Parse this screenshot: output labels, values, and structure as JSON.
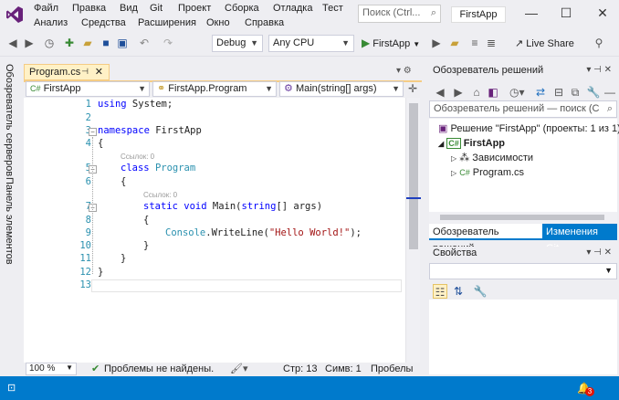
{
  "menu": {
    "row1": [
      "Файл",
      "Правка",
      "Вид",
      "Git",
      "Проект",
      "Сборка",
      "Отладка",
      "Тест"
    ],
    "row2": [
      "Анализ",
      "Средства",
      "Расширения",
      "Окно",
      "Справка"
    ]
  },
  "search": {
    "placeholder": "Поиск (Ctrl..."
  },
  "window": {
    "title": "FirstApp"
  },
  "toolbar": {
    "config": "Debug",
    "platform": "Any CPU",
    "run_label": "FirstApp",
    "liveshare_label": "Live Share"
  },
  "side_rail": {
    "server_explorer": "Обозреватель серверов",
    "toolbox": "Панель элементов"
  },
  "document_tab": {
    "label": "Program.cs"
  },
  "navbar": {
    "project": "FirstApp",
    "type": "FirstApp.Program",
    "member": "Main(string[] args)"
  },
  "code": {
    "line_numbers": [
      "1",
      "2",
      "3",
      "4",
      "5",
      "6",
      "7",
      "8",
      "9",
      "10",
      "11",
      "12",
      "13"
    ],
    "refs_label": "Ссылок: 0",
    "using": "using",
    "system": " System;",
    "namespace": "namespace",
    "ns_name": " FirstApp",
    "open_brace": "{",
    "close_brace": "}",
    "class_kw": "class",
    "class_name": "Program",
    "static_kw": "static",
    "void_kw": "void",
    "main": " Main(",
    "string_kw": "string",
    "args_rest": "[] args)",
    "console": "Console",
    "writeline": ".WriteLine(",
    "hello": "\"Hello World!\"",
    "stmt_end": ");"
  },
  "editor_status": {
    "zoom": "100 %",
    "issues": "Проблемы не найдены.",
    "line": "Стр: 13",
    "col": "Симв: 1",
    "spaces": "Пробелы"
  },
  "solution_explorer": {
    "title": "Обозреватель решений",
    "search_placeholder": "Обозреватель решений — поиск (C",
    "solution": "Решение \"FirstApp\" (проекты: 1 из 1)",
    "project": "FirstApp",
    "deps": "Зависимости",
    "file": "Program.cs",
    "tab_se": "Обозреватель решений",
    "tab_git": "Изменения Git"
  },
  "properties": {
    "title": "Свойства"
  },
  "statusbar": {
    "notifications": "3"
  },
  "colors": {
    "accent": "#007acc",
    "tab_active": "#fff1c6",
    "keyword": "#0000ff",
    "type": "#2b91af",
    "string": "#a31515"
  }
}
